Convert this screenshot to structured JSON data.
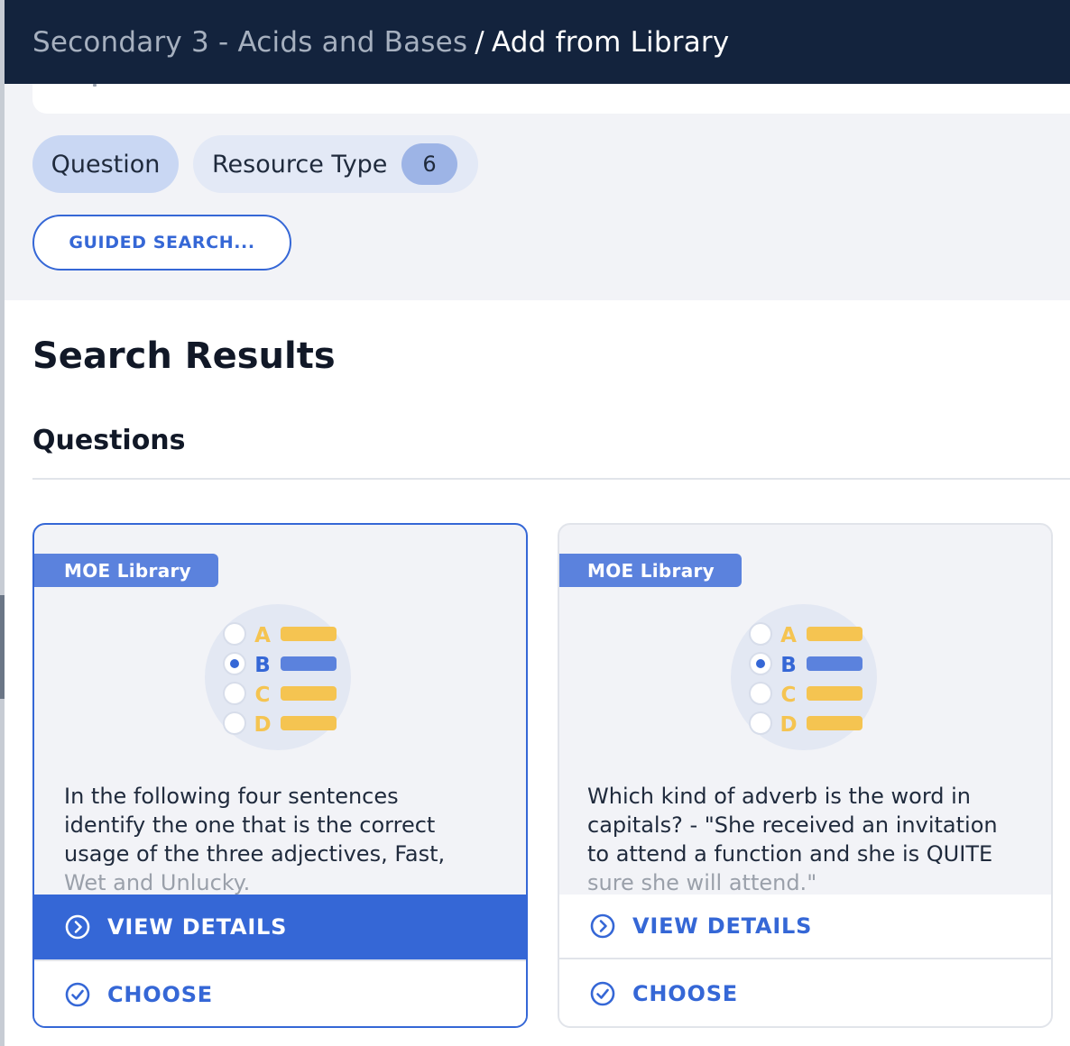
{
  "header": {
    "crumb": "Secondary 3 - Acids and Bases",
    "separator": "/",
    "current": "Add from Library"
  },
  "filters": {
    "question_chip": "Question",
    "resource_chip": "Resource Type",
    "resource_count": "6",
    "guided_search": "GUIDED SEARCH..."
  },
  "results": {
    "title": "Search Results",
    "section": "Questions"
  },
  "cards": [
    {
      "badge": "MOE Library",
      "text_main": "In the following four sentences identify the one that is the correct usage of the three adjectives, Fast,",
      "text_fade": "Wet and Unlucky.",
      "view": "VIEW DETAILS",
      "choose": "CHOOSE",
      "selected": true
    },
    {
      "badge": "MOE Library",
      "text_main": "Which kind of adverb is the word in capitals? - \"She received an invitation to attend a function and she is QUITE",
      "text_fade": "sure she will attend.\"",
      "view": "VIEW DETAILS",
      "choose": "CHOOSE",
      "selected": false
    }
  ],
  "illustration": {
    "options": [
      "A",
      "B",
      "C",
      "D"
    ],
    "selected_option": "B",
    "colors": {
      "yellow": "#f5c451",
      "blue": "#3567d6",
      "bar_blue": "#5b82dd",
      "circle_bg": "#e3e8f3"
    }
  },
  "icons": {
    "view": "chevron-circle-right-icon",
    "choose": "check-circle-icon"
  },
  "colors": {
    "header_bg": "#13233d",
    "accent": "#3567d6",
    "panel_bg": "#f2f3f7"
  }
}
